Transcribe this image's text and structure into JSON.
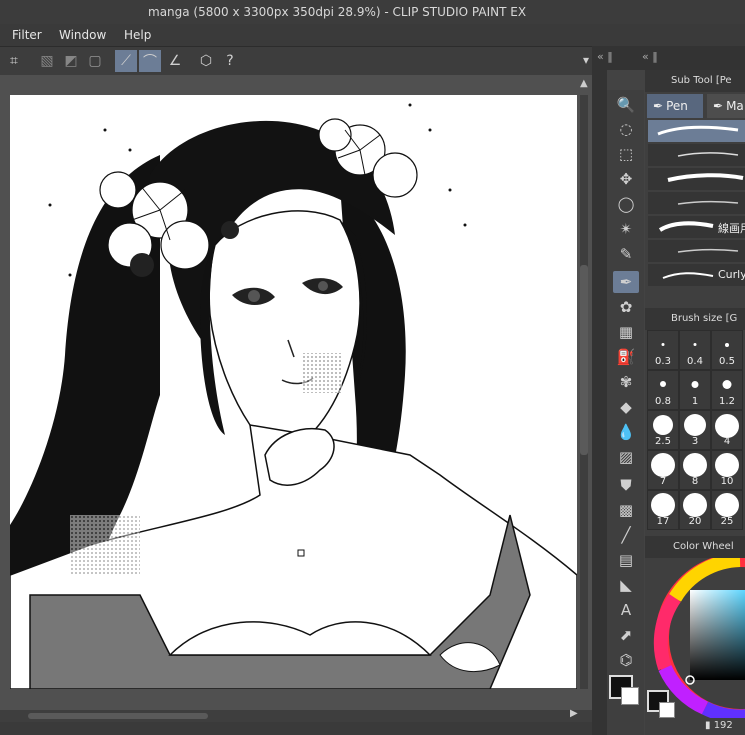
{
  "window": {
    "title": "manga (5800 x 3300px 350dpi 28.9%)  - CLIP STUDIO PAINT EX"
  },
  "menu": {
    "items": [
      "Filter",
      "Window",
      "Help"
    ]
  },
  "panels": {
    "subtool_header": "Sub Tool [Pe",
    "tabs": {
      "pen": "Pen",
      "marker": "Ma"
    },
    "brush_labels": {
      "kanji": "線画用",
      "curly": "Curly"
    },
    "brush_size_header": "Brush size [G",
    "brush_sizes": [
      "0.3",
      "0.4",
      "0.5",
      "0.8",
      "1",
      "1.2",
      "2.5",
      "3",
      "4",
      "7",
      "8",
      "10",
      "17",
      "20",
      "25"
    ],
    "color_wheel_header": "Color Wheel",
    "color_value": "192"
  },
  "colors": {
    "accent": "#6c7d96",
    "background": "#434343",
    "panel": "#3f3f3f"
  }
}
